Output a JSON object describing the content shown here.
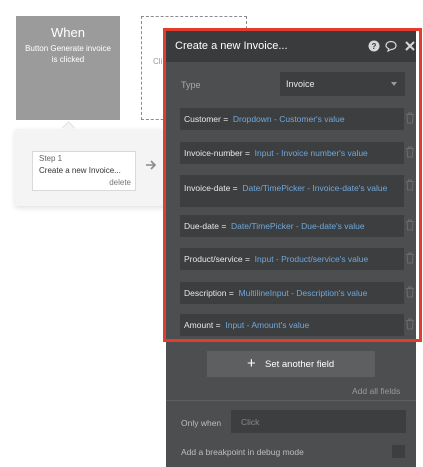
{
  "event": {
    "title": "When",
    "description": "Button Generate invoice is clicked"
  },
  "ghost_event": {
    "text": "Cli"
  },
  "step": {
    "number": "Step 1",
    "name": "Create a new Invoice...",
    "delete_label": "delete"
  },
  "panel": {
    "title": "Create a new Invoice...",
    "type_label": "Type",
    "type_value": "Invoice",
    "fields": [
      {
        "name": "Customer",
        "value": "Dropdown - Customer's value"
      },
      {
        "name": "Invoice-number",
        "value": "Input - Invoice number's value"
      },
      {
        "name": "Invoice-date",
        "value": "Date/TimePicker - Invoice-date's value"
      },
      {
        "name": "Due-date",
        "value": "Date/TimePicker - Due-date's value"
      },
      {
        "name": "Product/service",
        "value": "Input - Product/service's value"
      },
      {
        "name": "Description",
        "value": "MultilineInput - Description's value"
      },
      {
        "name": "Amount",
        "value": "Input - Amount's value"
      }
    ],
    "set_another_field_label": "Set another field",
    "add_all_fields_label": "Add all fields",
    "only_when_label": "Only when",
    "only_when_placeholder": "Click",
    "debug_label": "Add a breakpoint in debug mode"
  },
  "colors": {
    "highlight": "#e23c2f",
    "dynamic_value": "#6fa8dc",
    "panel_bg": "#4d4e50"
  }
}
